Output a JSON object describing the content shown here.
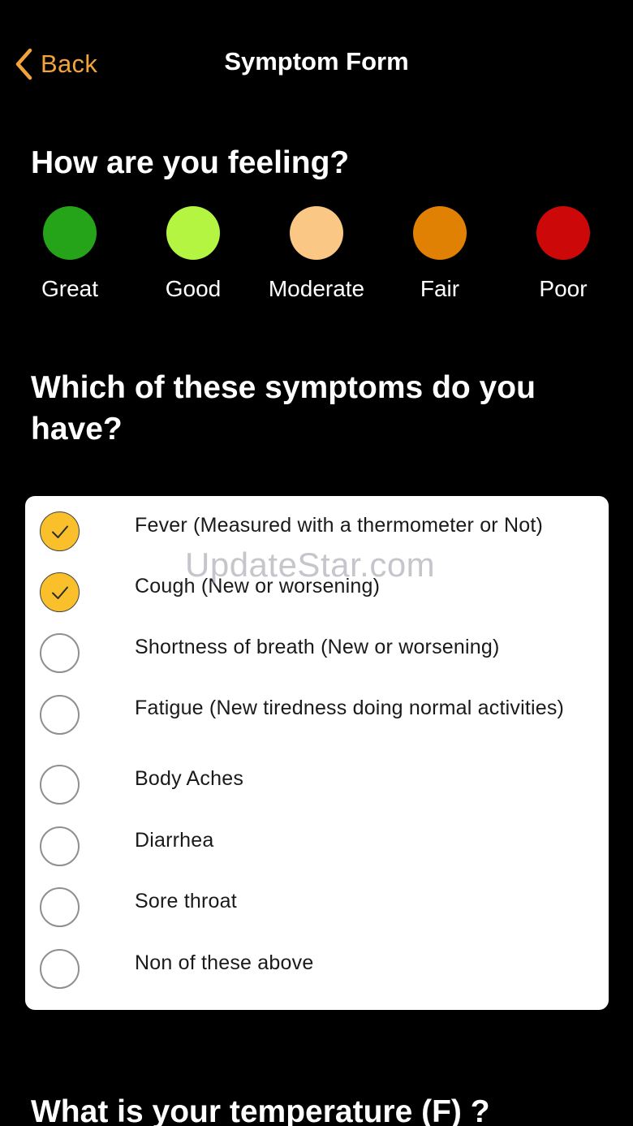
{
  "nav": {
    "back_label": "Back",
    "title": "Symptom Form",
    "accent_color": "#f2a33a"
  },
  "feeling": {
    "heading": "How are you feeling?",
    "options": [
      {
        "label": "Great",
        "color": "#25a319"
      },
      {
        "label": "Good",
        "color": "#b4f542"
      },
      {
        "label": "Moderate",
        "color": "#fbc784"
      },
      {
        "label": "Fair",
        "color": "#e08104"
      },
      {
        "label": "Poor",
        "color": "#cd0808"
      }
    ]
  },
  "symptoms": {
    "heading": "Which of these symptoms do you have?",
    "items": [
      {
        "label": "Fever (Measured with a thermometer or Not)",
        "checked": true
      },
      {
        "label": "Cough (New or worsening)",
        "checked": true
      },
      {
        "label": "Shortness of breath (New or worsening)",
        "checked": false
      },
      {
        "label": "Fatigue (New tiredness doing normal activities)",
        "checked": false
      },
      {
        "label": "Body Aches",
        "checked": false
      },
      {
        "label": "Diarrhea",
        "checked": false
      },
      {
        "label": "Sore throat",
        "checked": false
      },
      {
        "label": "Non of these above",
        "checked": false
      }
    ],
    "checked_color": "#f9c02b"
  },
  "watermark": "UpdateStar.com",
  "temperature": {
    "heading": "What is your temperature (F) ?"
  }
}
